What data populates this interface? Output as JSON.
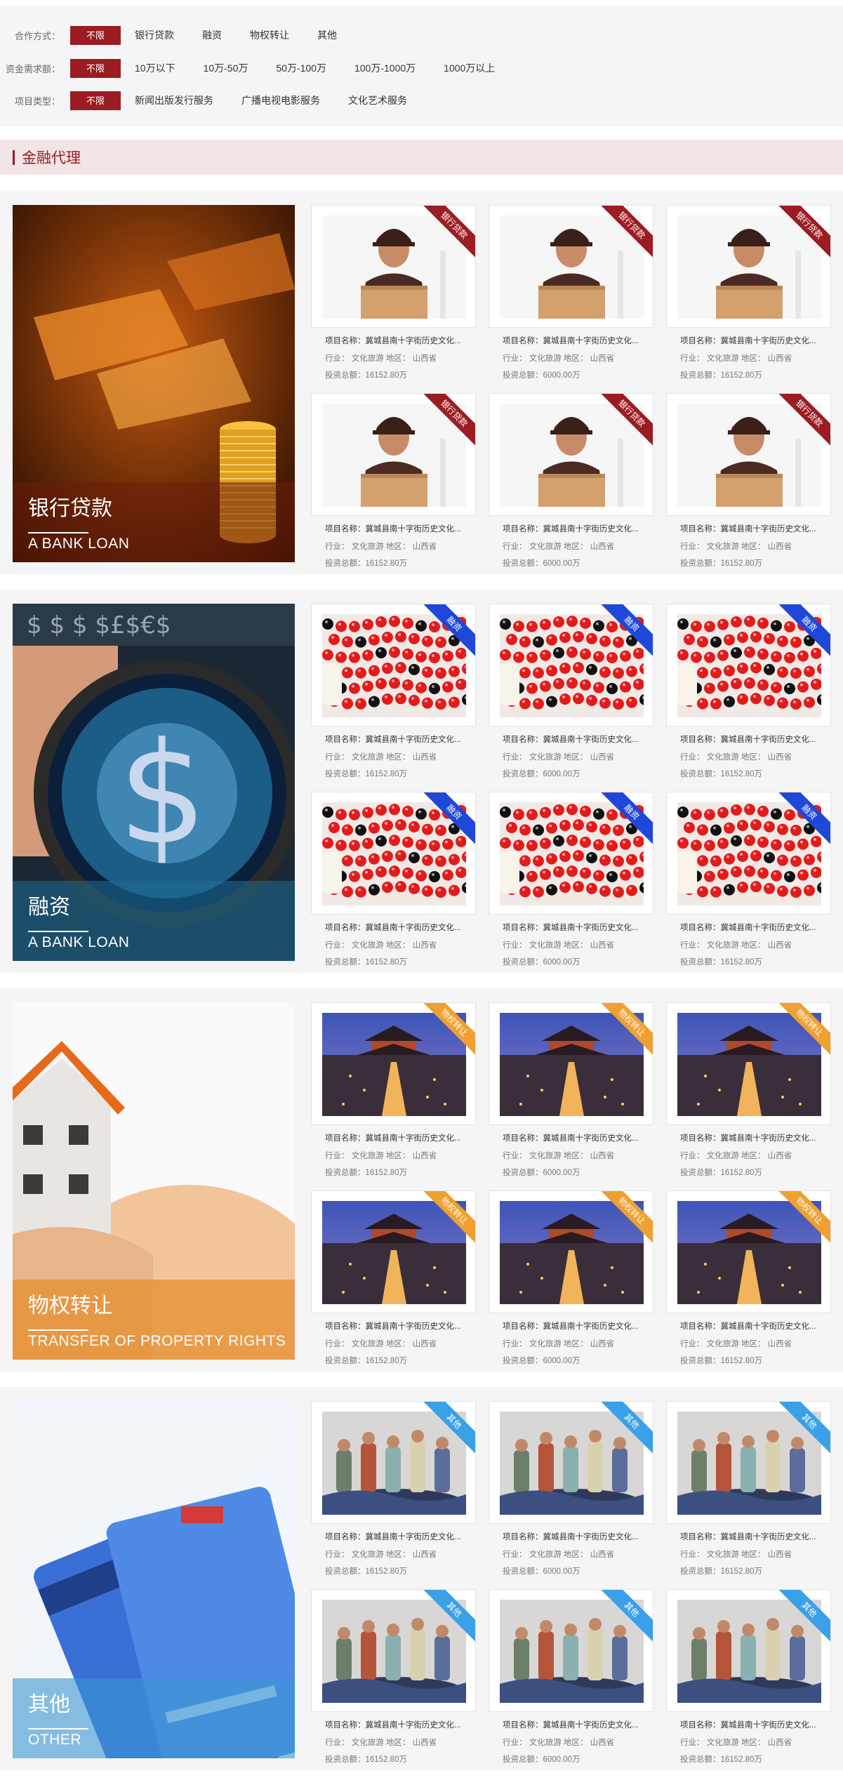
{
  "filters": [
    {
      "label": "合作方式：",
      "options": [
        "不限",
        "银行贷款",
        "融资",
        "物权转让",
        "其他"
      ]
    },
    {
      "label": "资金需求额：",
      "options": [
        "不限",
        "10万以下",
        "10万-50万",
        "50万-100万",
        "100万-1000万",
        "1000万以上"
      ]
    },
    {
      "label": "项目类型：",
      "options": [
        "不限",
        "新闻出版发行服务",
        "广播电视电影服务",
        "文化艺术服务"
      ]
    }
  ],
  "section_title": "金融代理",
  "categories": [
    {
      "cn": "银行贷款",
      "en": "A BANK LOAN",
      "ribbon": "银行贷款",
      "ribbon_color": "#9b1c22",
      "image": "man-with-box",
      "caption_color": "rgba(110,30,10,0.55)"
    },
    {
      "cn": "融资",
      "en": "A BANK LOAN",
      "ribbon": "融资",
      "ribbon_color": "#1f48d8",
      "image": "red-beads",
      "caption_color": "rgba(30,110,150,0.55)"
    },
    {
      "cn": "物权转让",
      "en": "TRANSFER OF PROPERTY RIGHTS",
      "ribbon": "物权转让",
      "ribbon_color": "#f0a030",
      "image": "ancient-city-night",
      "caption_color": "rgba(230,140,40,0.7)"
    },
    {
      "cn": "其他",
      "en": "OTHER",
      "ribbon": "其他",
      "ribbon_color": "#3aa0e8",
      "image": "figurines",
      "caption_color": "rgba(60,150,210,0.6)"
    }
  ],
  "cards": [
    {
      "name": "项目名称：冀城县南十字街历史文化...",
      "info": "行业： 文化旅游  地区： 山西省",
      "total": "投资总额：16152.80万"
    },
    {
      "name": "项目名称：冀城县南十字街历史文化...",
      "info": "行业： 文化旅游  地区： 山西省",
      "total": "投资总额：6000.00万"
    },
    {
      "name": "项目名称：冀城县南十字街历史文化...",
      "info": "行业： 文化旅游  地区： 山西省",
      "total": "投资总额：16152.80万"
    },
    {
      "name": "项目名称：冀城县南十字街历史文化...",
      "info": "行业： 文化旅游  地区： 山西省",
      "total": "投资总额：16152.80万"
    },
    {
      "name": "项目名称：冀城县南十字街历史文化...",
      "info": "行业： 文化旅游  地区： 山西省",
      "total": "投资总额：6000.00万"
    },
    {
      "name": "项目名称：冀城县南十字街历史文化...",
      "info": "行业： 文化旅游  地区： 山西省",
      "total": "投资总额：16152.80万"
    }
  ],
  "colors": {
    "accent": "#9b1c22",
    "section_bg": "#f3e5e5",
    "panel_bg": "#f5f5f5"
  }
}
